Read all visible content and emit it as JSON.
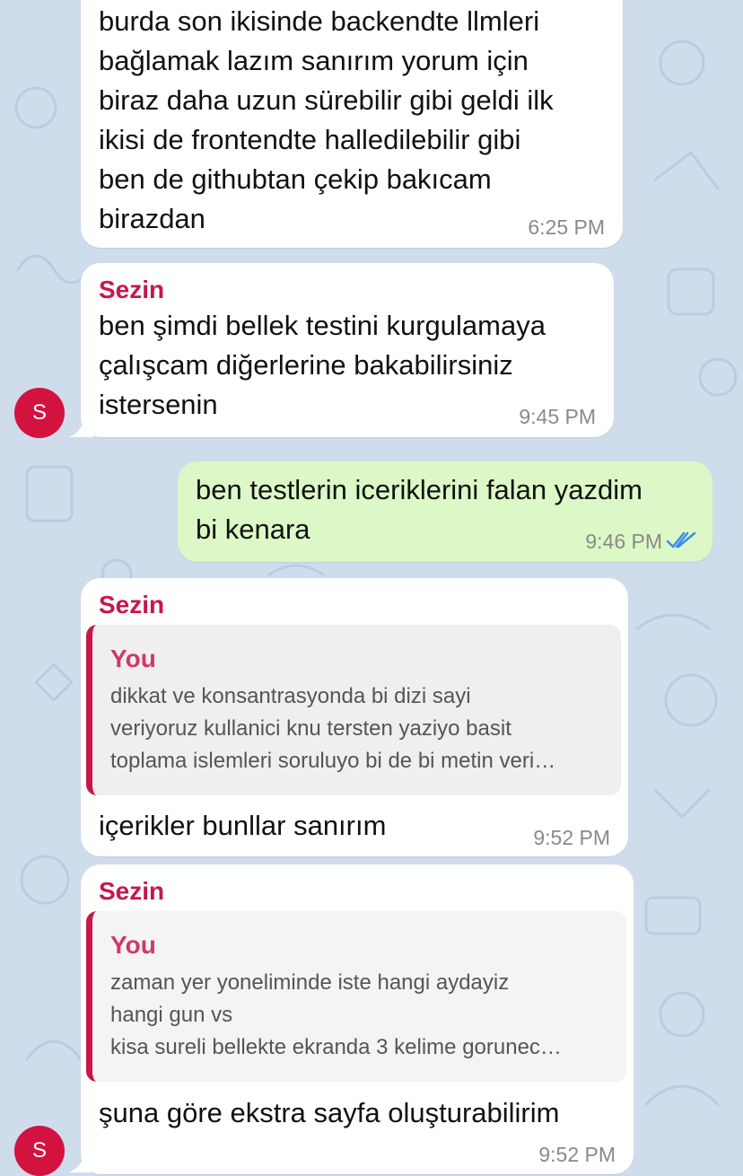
{
  "theme": {
    "wallpaper": "#cfdcec",
    "incoming_bubble": "#ffffff",
    "outgoing_bubble": "#dcf8c6",
    "sender_name": "#c8174a",
    "avatar": "#d21340",
    "read_receipt": "#3a8ee8"
  },
  "messages": [
    {
      "text": "burda son ikisinde backendte llmleri\nbağlamak lazım sanırım yorum için\nbiraz daha uzun sürebilir gibi geldi ilk\nikisi de frontendte halledilebilir gibi\nben de githubtan çekip bakıcam\nbirazdan",
      "time": "6:25 PM"
    },
    {
      "sender": "Sezin",
      "text": "ben şimdi bellek testini kurgulamaya\nçalışcam diğerlerine bakabilirsiniz\nistersenin",
      "time": "9:45 PM",
      "avatar_initial": "S"
    },
    {
      "text": "ben testlerin iceriklerini falan yazdim\nbi kenara",
      "time": "9:46 PM",
      "status_icon": "double-check-icon"
    },
    {
      "sender": "Sezin",
      "reply_author": "You",
      "reply_text": "dikkat ve konsantrasyonda bi dizi sayi\nveriyoruz kullanici knu tersten yaziyo basit\ntoplama islemleri soruluyo bi de bi metin veri…",
      "text": "içerikler bunllar sanırım",
      "time": "9:52 PM"
    },
    {
      "sender": "Sezin",
      "reply_author": "You",
      "reply_text": "zaman yer yoneliminde iste hangi aydayiz\nhangi gun vs\nkisa sureli bellekte ekranda 3 kelime gorunec…",
      "text": "şuna göre ekstra sayfa oluşturabilirim",
      "time": "9:52 PM",
      "avatar_initial": "S"
    }
  ]
}
